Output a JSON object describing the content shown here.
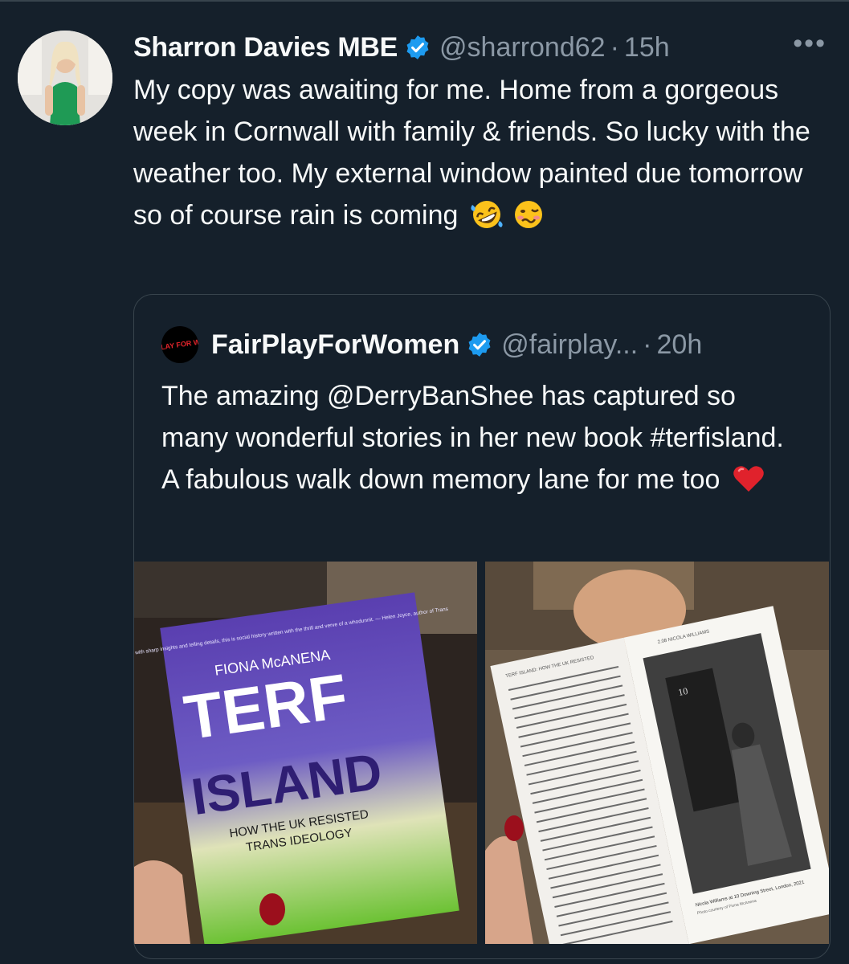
{
  "tweet": {
    "author_name": "Sharron Davies MBE",
    "handle": "@sharrond62",
    "separator": "·",
    "time": "15h",
    "more_label": "•••",
    "text_before_emoji": "My copy was awaiting for me. Home from a gorgeous week in Cornwall with family & friends. So lucky with the weather too. My external window  painted due tomorrow so of course rain is coming",
    "emojis": [
      "rolling-on-floor-laughing-emoji",
      "woozy-face-emoji"
    ]
  },
  "quote": {
    "author_name": "FairPlayForWomen",
    "handle": "@fairplay...",
    "separator": "·",
    "time": "20h",
    "avatar_text": "FAIR PLAY FOR WOMEN",
    "text": "The amazing @DerryBanShee has captured so many wonderful stories in her new book #terfisland. A fabulous walk down memory lane for me too",
    "emoji": "red-heart-emoji"
  },
  "book_cover": {
    "blurb": "Packed with sharp insights and telling details, this is social history written with the thrill and verve of a whodunnit. — Helen Joyce, author of Trans",
    "author": "FIONA McANENA",
    "title_line1": "TERF",
    "title_line2": "ISLAND",
    "subtitle_line1": "HOW THE UK RESISTED",
    "subtitle_line2": "TRANS IDEOLOGY"
  },
  "book_page": {
    "running_head": "TERF ISLAND: HOW THE UK RESISTED",
    "photo_header": "2.08 NICOLA WILLIAMS",
    "door_number": "10",
    "caption": "Nicola Williams at 10 Downing Street, London, 2021",
    "credit": "Photo courtesy of Fiona McAnena"
  },
  "colors": {
    "background": "#15202b",
    "text": "#f7f9f9",
    "muted": "#8b98a5",
    "verified": "#1d9bf0",
    "border": "#38444d"
  }
}
